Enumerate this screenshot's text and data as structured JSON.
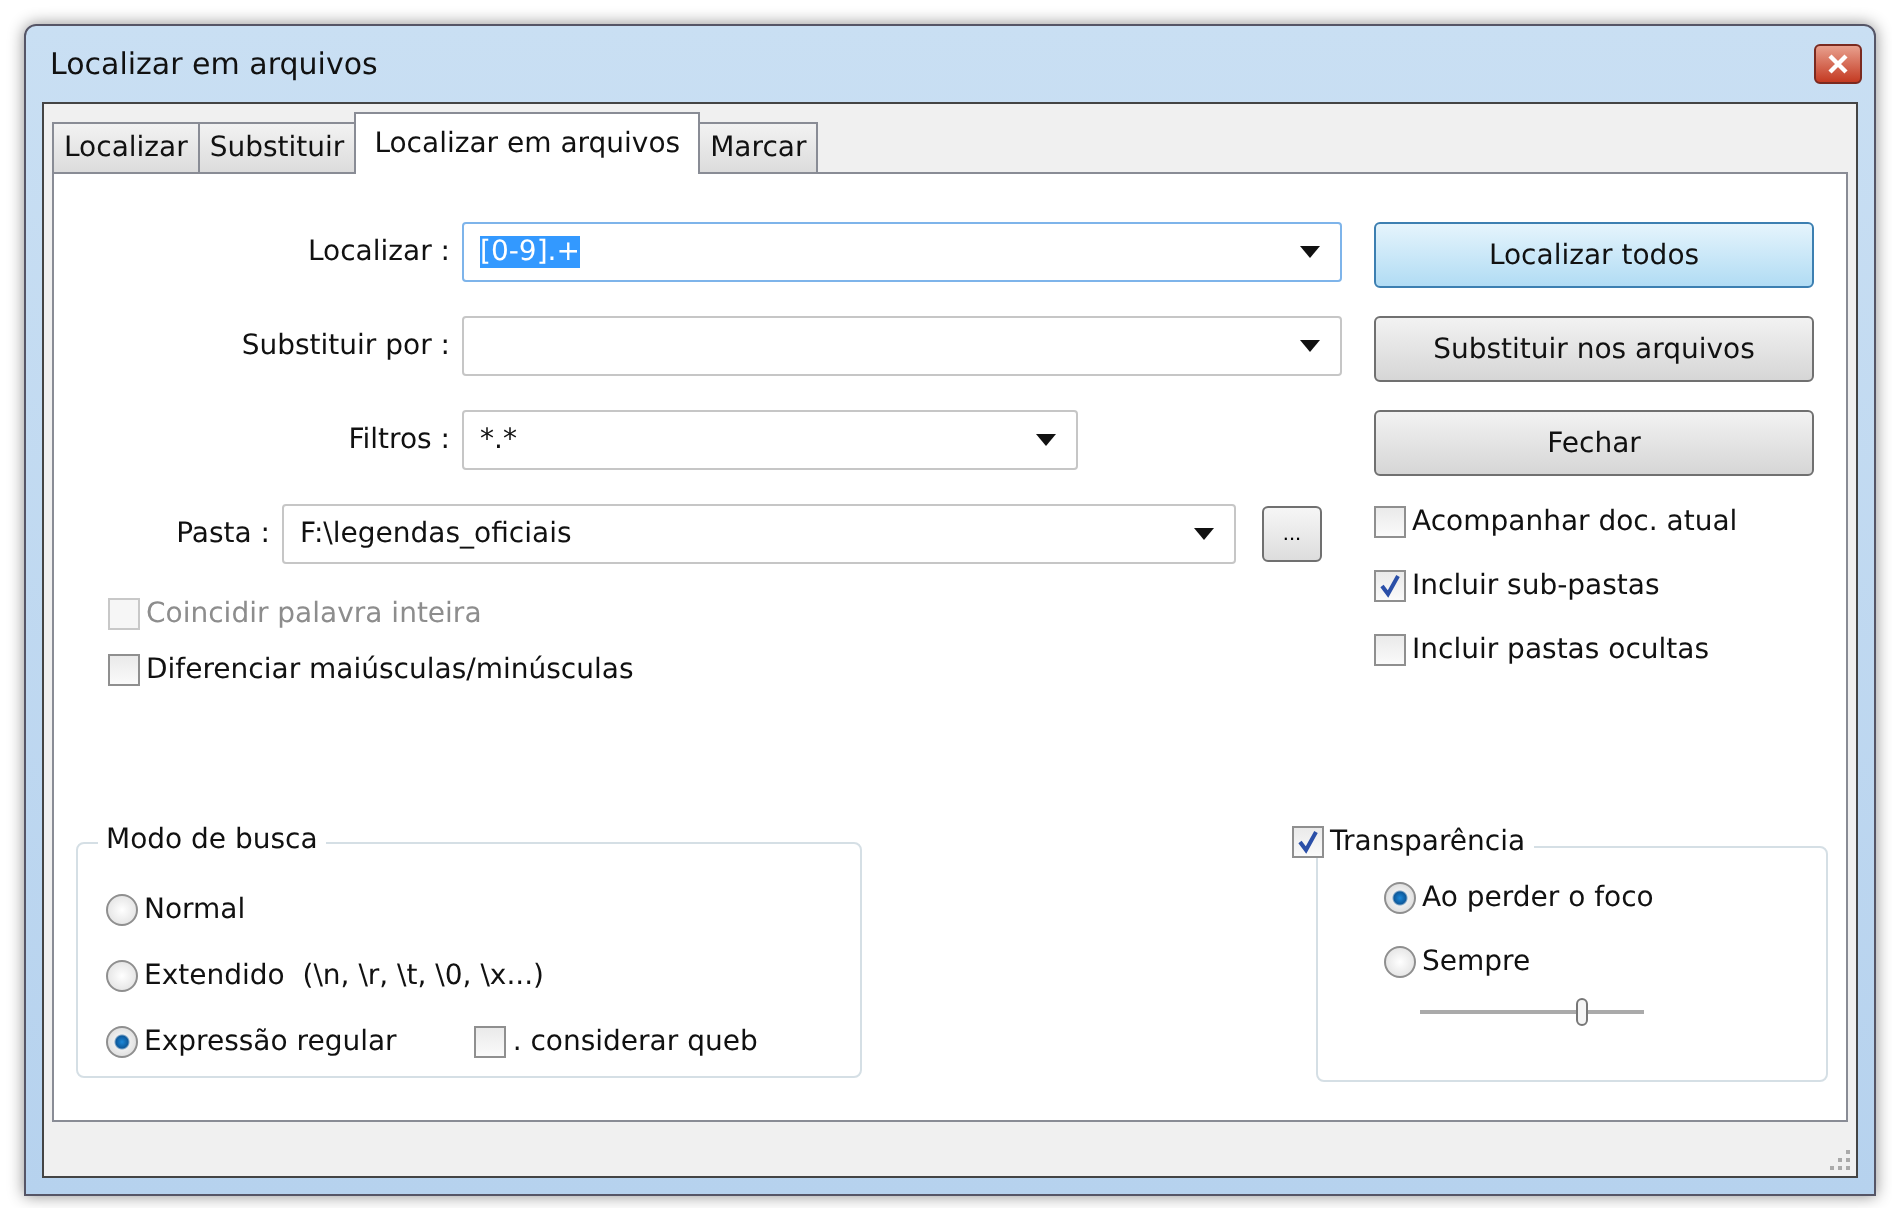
{
  "window": {
    "title": "Localizar em arquivos"
  },
  "tabs": [
    {
      "label": "Localizar",
      "selected": false
    },
    {
      "label": "Substituir",
      "selected": false
    },
    {
      "label": "Localizar em arquivos",
      "selected": true
    },
    {
      "label": "Marcar",
      "selected": false
    }
  ],
  "fields": [
    {
      "label": "Localizar :",
      "value": "[0-9].+",
      "highlighted": true
    },
    {
      "label": "Substituir por :",
      "highlighted": false
    },
    {
      "label": "Filtros :",
      "value": "*.*",
      "highlighted": false
    }
  ],
  "folder": {
    "label": "Pasta :",
    "value": "F:\\legendas_oficiais",
    "browse": "..."
  },
  "options": [
    {
      "label": "Coincidir palavra inteira",
      "checked": false,
      "disabled": true
    },
    {
      "label": "Diferenciar maiúsculas/minúsculas",
      "checked": false,
      "disabled": false
    }
  ],
  "buttons": [
    {
      "label": "Localizar todos",
      "default": true
    },
    {
      "label": "Substituir nos arquivos",
      "default": false
    },
    {
      "label": "Fechar",
      "default": false
    }
  ],
  "folder_options": [
    {
      "label": "Acompanhar doc. atual",
      "checked": false
    },
    {
      "label": "Incluir sub-pastas",
      "checked": true
    },
    {
      "label": "Incluir pastas ocultas",
      "checked": false
    }
  ],
  "search_mode": {
    "title": "Modo de busca",
    "modes": [
      {
        "label": "Normal",
        "selected": false
      },
      {
        "label": "Extendido  (\\n, \\r, \\t, \\0, \\x...)",
        "selected": false
      },
      {
        "label": "Expressão regular",
        "selected": true
      }
    ],
    "dot_option": {
      "label": ". considerar queb",
      "checked": false
    }
  },
  "transparency": {
    "label": "Transparência",
    "checked": true,
    "modes": [
      {
        "label": "Ao perder o foco",
        "selected": true
      },
      {
        "label": "Sempre",
        "selected": false
      }
    ],
    "level": 0.72
  }
}
